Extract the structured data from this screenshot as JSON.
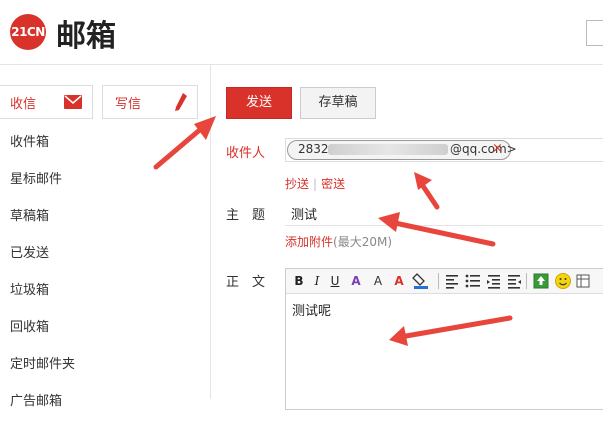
{
  "header": {
    "logo_badge": "21CN",
    "logo_text": "邮箱"
  },
  "sidebar": {
    "inbox_button": "收信",
    "write_button": "写信",
    "folders": [
      "收件箱",
      "星标邮件",
      "草稿箱",
      "已发送",
      "垃圾箱",
      "回收箱",
      "定时邮件夹",
      "广告邮箱"
    ]
  },
  "compose": {
    "send_label": "发送",
    "save_draft_label": "存草稿",
    "to_label": "收件人",
    "recipient_prefix": "2832",
    "recipient_suffix": "@qq.com>",
    "chip_remove": "×",
    "cc_label": "抄送",
    "bcc_label": "密送",
    "subject_label": "主　题",
    "subject_value": "测试",
    "attach_label": "添加附件",
    "attach_note": "(最大20M)",
    "body_label": "正　文",
    "body_text": "测试呢"
  },
  "colors": {
    "accent": "#d8322b",
    "annotation_arrow": "#e8453c"
  }
}
